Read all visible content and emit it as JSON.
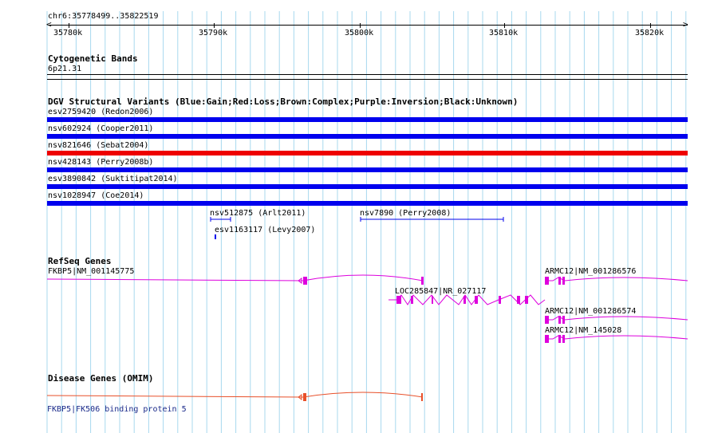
{
  "ruler": {
    "locus": "chr6:35778499..35822519",
    "ticks": [
      "35780k",
      "35790k",
      "35800k",
      "35810k",
      "35820k"
    ]
  },
  "cytobands": {
    "title": "Cytogenetic Bands",
    "band": "6p21.31"
  },
  "dgv": {
    "title": "DGV Structural Variants (Blue:Gain;Red:Loss;Brown:Complex;Purple:Inversion;Black:Unknown)",
    "variants": [
      {
        "label": "esv2759420 (Redon2006)",
        "type": "gain"
      },
      {
        "label": "nsv602924 (Cooper2011)",
        "type": "gain"
      },
      {
        "label": "nsv821646 (Sebat2004)",
        "type": "loss"
      },
      {
        "label": "nsv428143 (Perry2008b)",
        "type": "gain"
      },
      {
        "label": "esv3890842 (Suktitipat2014)",
        "type": "gain"
      },
      {
        "label": "nsv1028947 (Coe2014)",
        "type": "gain"
      }
    ],
    "small": [
      {
        "label": "nsv512875 (Arlt2011)"
      },
      {
        "label": "nsv7890 (Perry2008)"
      },
      {
        "label": "esv1163117 (Levy2007)"
      }
    ],
    "colors": {
      "gain": "#0000ee",
      "loss": "#ee0000"
    }
  },
  "refseq": {
    "title": "RefSeq Genes",
    "genes": [
      {
        "label": "FKBP5|NM_001145775"
      },
      {
        "label": "LOC285847|NR_027117"
      },
      {
        "label": "ARMC12|NM_001286576"
      },
      {
        "label": "ARMC12|NM_001286574"
      },
      {
        "label": "ARMC12|NM_145028"
      }
    ],
    "color": "#dd00dd"
  },
  "disease": {
    "title": "Disease Genes (OMIM)",
    "gene_label": "FKBP5|FK506 binding protein 5",
    "color": "#e8502a",
    "link_color": "#1a2a8a"
  },
  "grid_color": "#a8d8ee"
}
